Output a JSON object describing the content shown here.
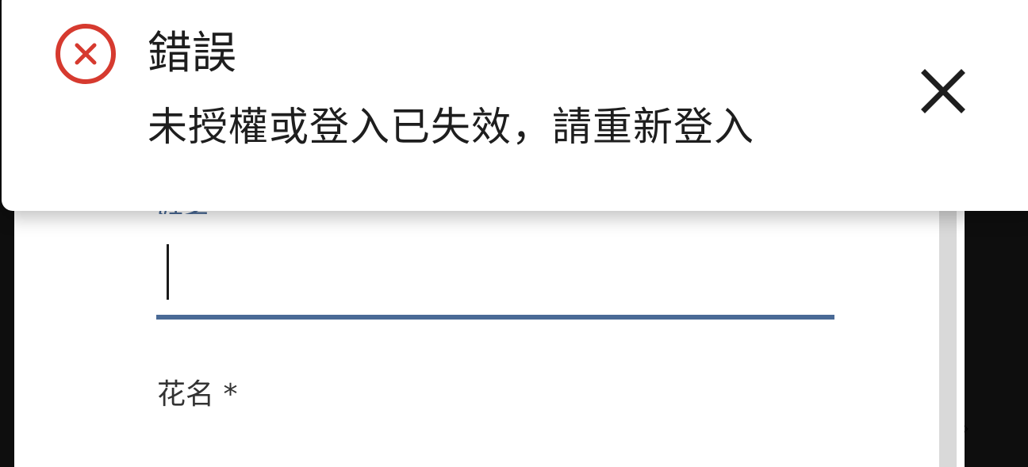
{
  "dialog": {
    "partial_label": "姓名",
    "name_field": {
      "label": "花名 *"
    },
    "arrow_glyph": "›"
  },
  "toast": {
    "type": "error",
    "icon": "error-circle-x-icon",
    "title": "錯誤",
    "message": "未授權或登入已失效，請重新登入",
    "close_icon": "close-icon",
    "colors": {
      "error": "#d63a2f",
      "text": "#1e1e1e",
      "accent": "#4a6a96"
    }
  }
}
